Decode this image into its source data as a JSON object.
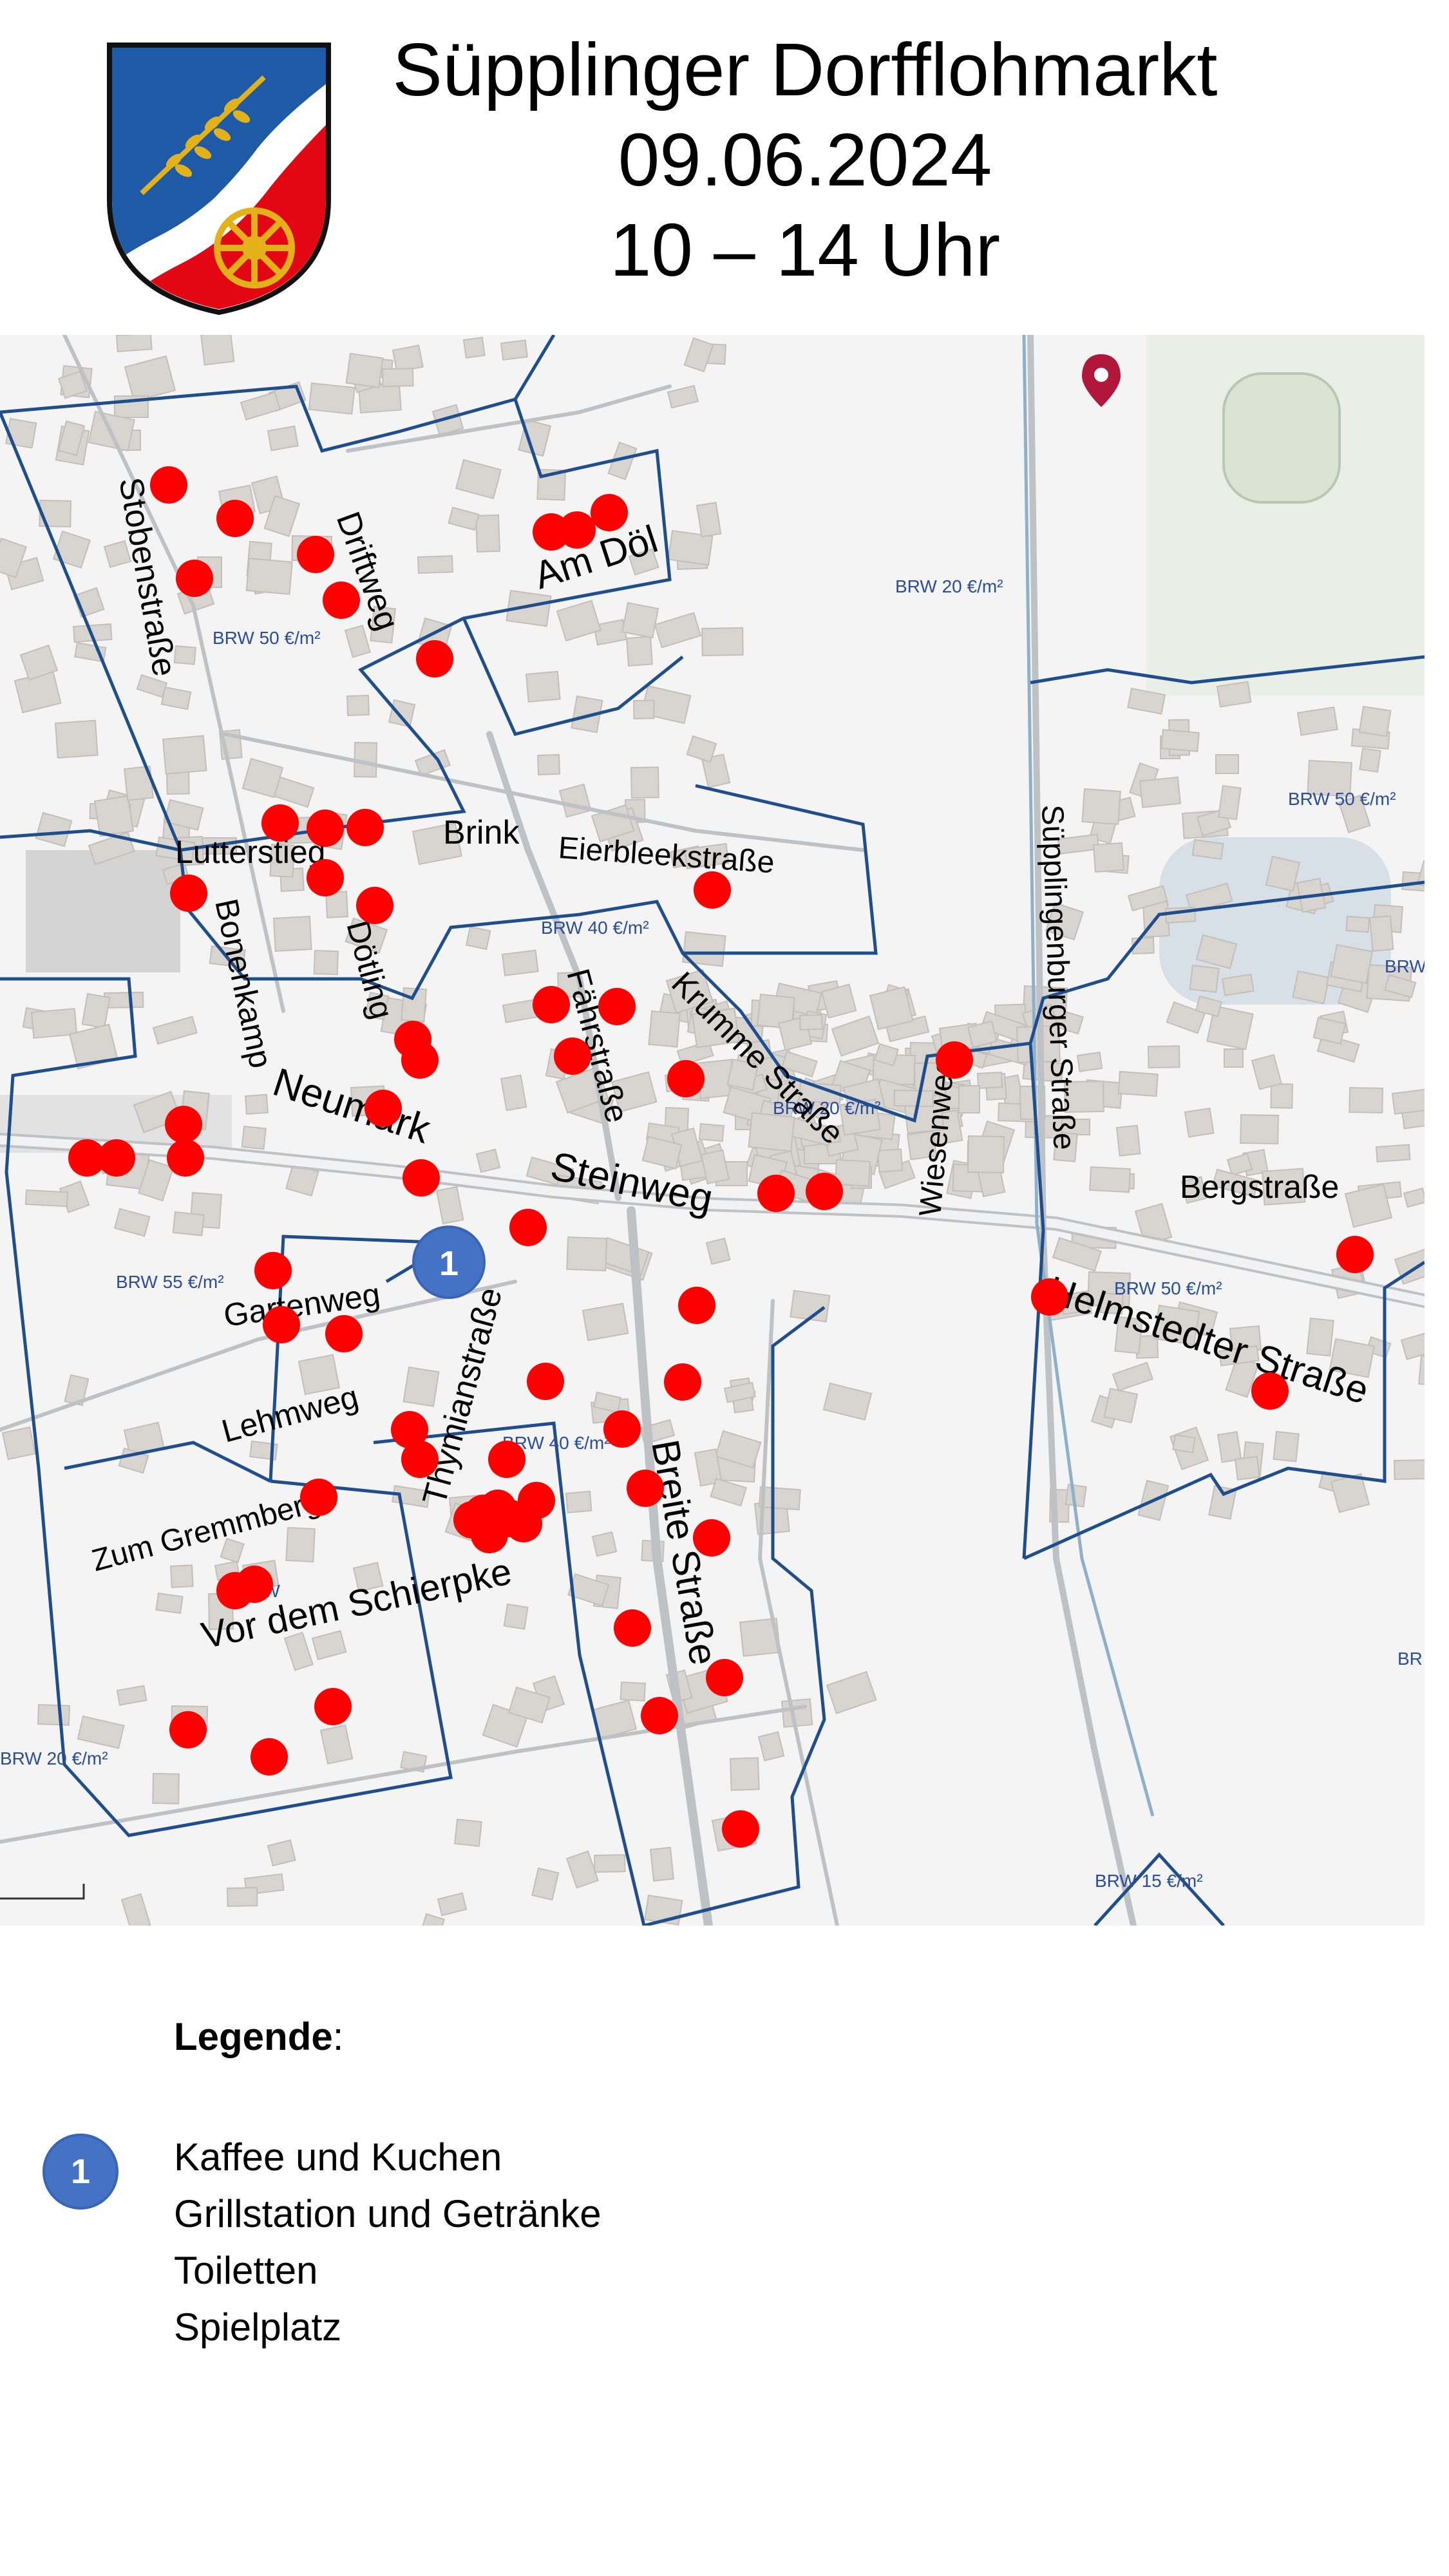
{
  "title": {
    "line1": "Süpplinger Dorfflohmarkt",
    "line2": "09.06.2024",
    "line3": "10 – 14 Uhr"
  },
  "colors": {
    "stall_dot": "#ff0000",
    "district_border": "#1f4e8c",
    "badge": "#4472c4",
    "crest_blue": "#1f5aa6",
    "crest_red": "#e30613",
    "crest_gold": "#e3b21a"
  },
  "map": {
    "streets": [
      "Stobenstraße",
      "Driftweg",
      "Am Döl",
      "Brink",
      "Lutterstieg",
      "Eierbleekstraße",
      "Bonenkamp",
      "Dötling",
      "Fährstraße",
      "Krumme Straße",
      "Wiesenweg",
      "Süpplingenburger Straße",
      "Neumark",
      "Steinweg",
      "Bergstraße",
      "Helmstedter Straße",
      "Gartenweg",
      "Thymianstraße",
      "Lehmweg",
      "Zum Gremmberge",
      "Breite Straße",
      "Vor dem Schierpke"
    ],
    "brw_labels": [
      "BRW 20 €/m²",
      "BRW 50 €/m²",
      "BRW 50 €/m²",
      "BRW 40 €/m²",
      "BRW",
      "BRW 20 €/m²",
      "BRW 55 €/m²",
      "BRW 50 €/m²",
      "BRW 40 €/m²",
      "BRW",
      "BRW 20 €/m²",
      "BRW 15 €/m²",
      "BR"
    ],
    "location_pin_icon": "map-pin-icon",
    "station_marker": "1"
  },
  "legend": {
    "title": "Legende",
    "title_suffix": ":",
    "badge": "1",
    "items": [
      "Kaffee und Kuchen",
      "Grillstation und Getränke",
      "Toiletten",
      "Spielplatz"
    ]
  }
}
